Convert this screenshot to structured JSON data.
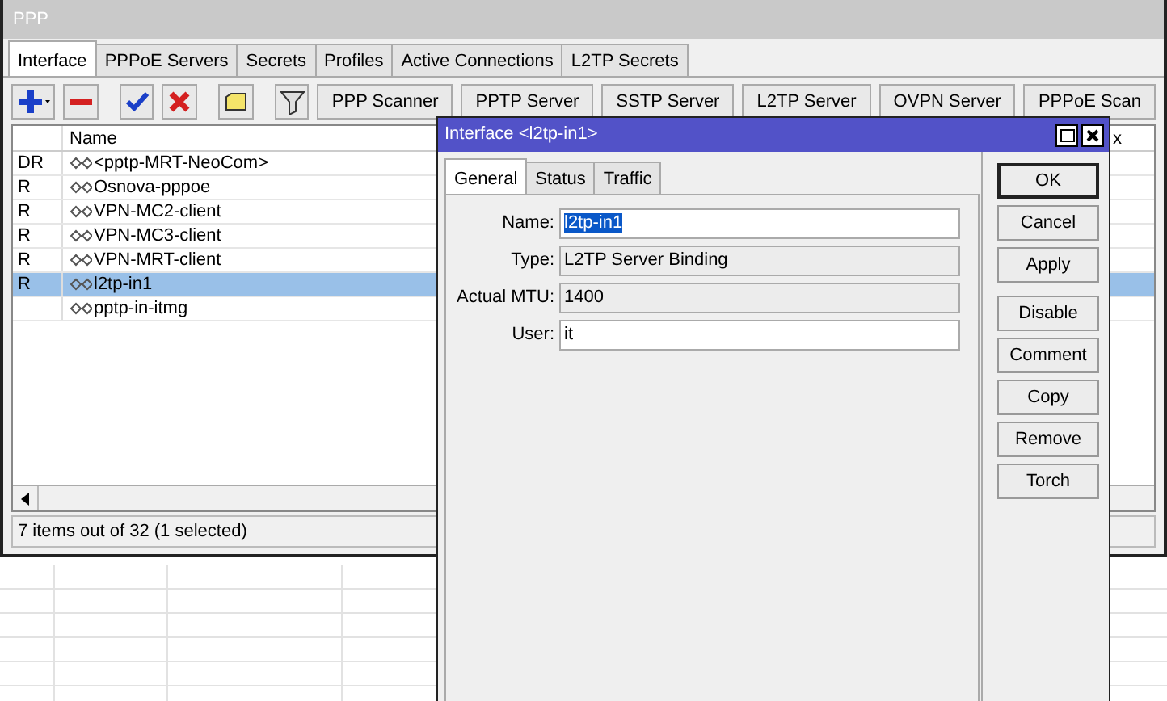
{
  "window": {
    "title": "PPP"
  },
  "tabs": [
    {
      "label": "Interface",
      "selected": true
    },
    {
      "label": "PPPoE Servers",
      "selected": false
    },
    {
      "label": "Secrets",
      "selected": false
    },
    {
      "label": "Profiles",
      "selected": false
    },
    {
      "label": "Active Connections",
      "selected": false
    },
    {
      "label": "L2TP Secrets",
      "selected": false
    }
  ],
  "toolbar_buttons": [
    "PPP Scanner",
    "PPTP Server",
    "SSTP Server",
    "L2TP Server",
    "OVPN Server",
    "PPPoE Scan"
  ],
  "table": {
    "columns": [
      "Name"
    ],
    "column_3": "x",
    "rows": [
      {
        "flags": "DR",
        "name": "<pptp-MRT-NeoCom>",
        "selected": false
      },
      {
        "flags": "R",
        "name": "Osnova-pppoe",
        "selected": false
      },
      {
        "flags": "R",
        "name": "VPN-MC2-client",
        "selected": false
      },
      {
        "flags": "R",
        "name": "VPN-MC3-client",
        "selected": false
      },
      {
        "flags": "R",
        "name": "VPN-MRT-client",
        "selected": false
      },
      {
        "flags": "R",
        "name": "l2tp-in1",
        "selected": true
      },
      {
        "flags": "",
        "name": "pptp-in-itmg",
        "selected": false
      }
    ]
  },
  "status_bar": "7 items out of 32 (1 selected)",
  "dialog": {
    "title": "Interface <l2tp-in1>",
    "tabs": [
      {
        "label": "General",
        "selected": true
      },
      {
        "label": "Status",
        "selected": false
      },
      {
        "label": "Traffic",
        "selected": false
      }
    ],
    "fields": [
      {
        "label": "Name:",
        "value": "l2tp-in1",
        "kind": "input",
        "highlighted": true
      },
      {
        "label": "Type:",
        "value": "L2TP Server Binding",
        "kind": "readonly",
        "highlighted": false
      },
      {
        "label": "Actual MTU:",
        "value": "1400",
        "kind": "readonly",
        "highlighted": false
      },
      {
        "label": "User:",
        "value": "it",
        "kind": "input",
        "highlighted": false
      }
    ],
    "button_groups": [
      [
        {
          "label": "OK",
          "default": true
        },
        {
          "label": "Cancel",
          "default": false
        },
        {
          "label": "Apply",
          "default": false
        }
      ],
      [
        {
          "label": "Disable",
          "default": false
        },
        {
          "label": "Comment",
          "default": false
        },
        {
          "label": "Copy",
          "default": false
        },
        {
          "label": "Remove",
          "default": false
        },
        {
          "label": "Torch",
          "default": false
        }
      ]
    ]
  }
}
